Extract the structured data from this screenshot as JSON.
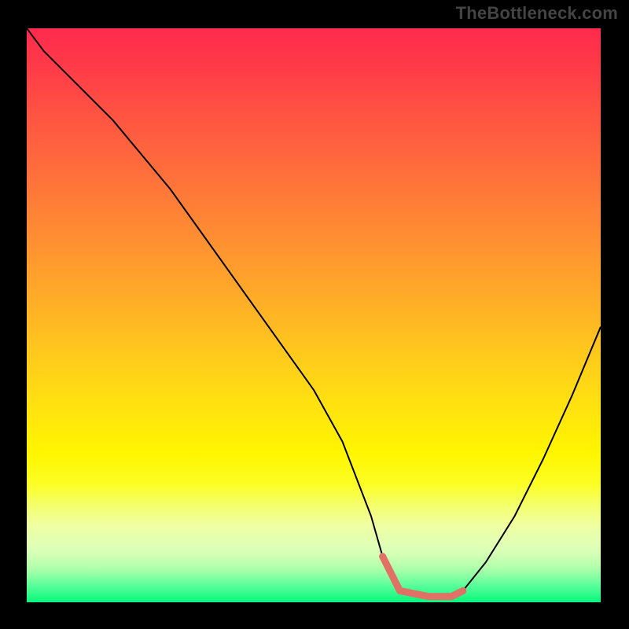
{
  "watermark": "TheBottleneck.com",
  "colors": {
    "background": "#000000",
    "curve": "#000000",
    "highlight": "#e17065",
    "gradient_top": "#ff2a4d",
    "gradient_bottom": "#05f77b"
  },
  "chart_data": {
    "type": "line",
    "title": "",
    "xlabel": "",
    "ylabel": "",
    "xlim": [
      0,
      100
    ],
    "ylim": [
      0,
      100
    ],
    "legend": false,
    "grid": false,
    "background": "vertical red→yellow→green gradient",
    "series": [
      {
        "name": "bottleneck-curve",
        "x": [
          0,
          3,
          8,
          15,
          20,
          25,
          30,
          35,
          40,
          45,
          50,
          55,
          60,
          62,
          65,
          70,
          74,
          76,
          80,
          85,
          90,
          95,
          100
        ],
        "y": [
          100,
          96,
          91,
          84,
          78,
          72,
          65,
          58,
          51,
          44,
          37,
          28,
          15,
          8,
          2,
          1,
          1,
          2,
          7,
          15,
          25,
          36,
          48
        ]
      }
    ],
    "annotations": [
      {
        "name": "optimal-range-highlight",
        "type": "segment",
        "x": [
          62,
          65,
          70,
          74,
          76
        ],
        "y": [
          8,
          2,
          1,
          1,
          2
        ],
        "color": "#e17065",
        "note": "thick salmon segment marking the curve's minimum (optimal zone)"
      }
    ]
  }
}
